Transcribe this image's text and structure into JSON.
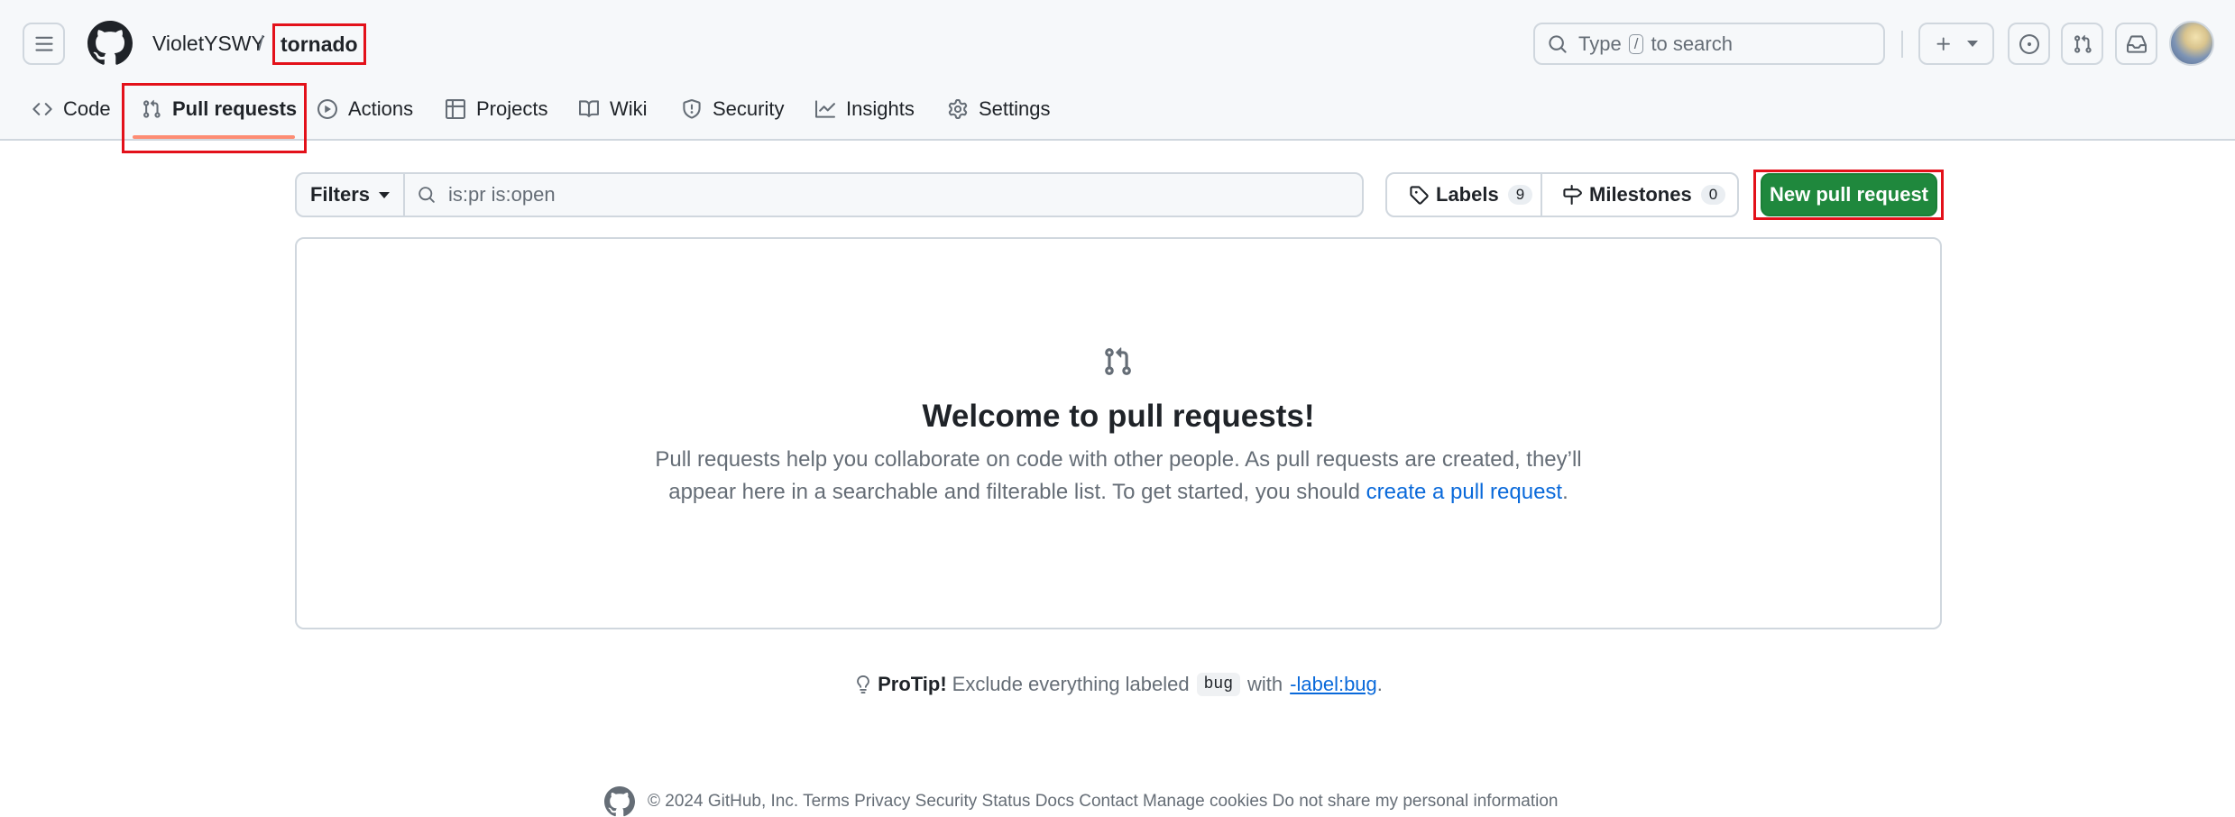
{
  "header": {
    "owner": "VioletYSWY",
    "separator": "/",
    "repo": "tornado",
    "search": {
      "prefix": "Type",
      "key": "/",
      "suffix": "to search"
    }
  },
  "tabs": [
    {
      "label": "Code",
      "icon": "code-icon"
    },
    {
      "label": "Pull requests",
      "icon": "git-pull-request-icon",
      "selected": true
    },
    {
      "label": "Actions",
      "icon": "play-icon"
    },
    {
      "label": "Projects",
      "icon": "table-icon"
    },
    {
      "label": "Wiki",
      "icon": "book-icon"
    },
    {
      "label": "Security",
      "icon": "shield-icon"
    },
    {
      "label": "Insights",
      "icon": "graph-icon"
    },
    {
      "label": "Settings",
      "icon": "gear-icon"
    }
  ],
  "filterbar": {
    "filters_label": "Filters",
    "query": "is:pr is:open",
    "labels": {
      "label": "Labels",
      "count": "9"
    },
    "milestones": {
      "label": "Milestones",
      "count": "0"
    },
    "new_pr_label": "New pull request"
  },
  "blankslate": {
    "title": "Welcome to pull requests!",
    "text_before": "Pull requests help you collaborate on code with other people. As pull requests are created, they’ll appear here in a searchable and filterable list. To get started, you should ",
    "link": "create a pull request",
    "text_after": "."
  },
  "protip": {
    "bold": "ProTip!",
    "text1": "Exclude everything labeled",
    "chip": "bug",
    "text2": "with",
    "link": "-label:bug",
    "end": "."
  },
  "footer": {
    "text": "© 2024 GitHub, Inc.   Terms   Privacy   Security   Status   Docs   Contact   Manage cookies   Do not share my personal information"
  },
  "colors": {
    "accent_green": "#1f883d",
    "link_blue": "#0969da",
    "tab_underline": "#fd8c73",
    "highlight_red": "#e3111a"
  }
}
